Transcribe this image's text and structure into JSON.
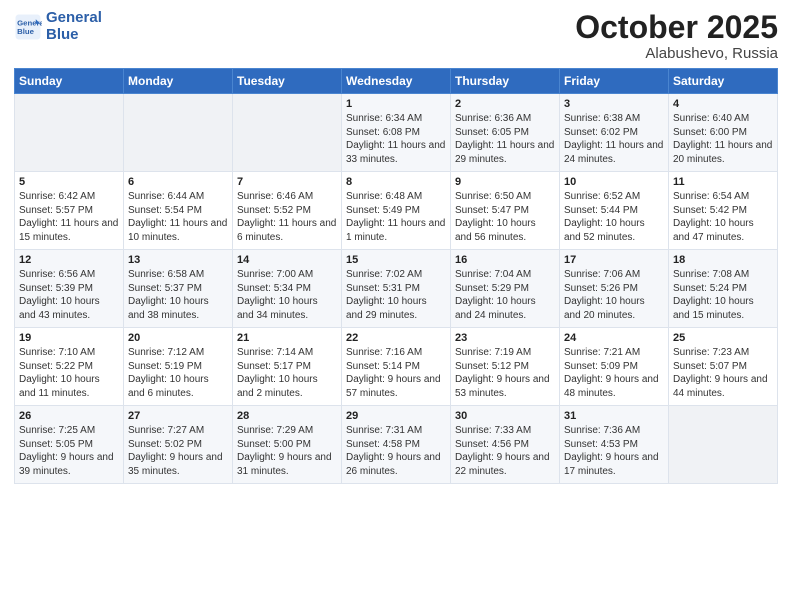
{
  "logo": {
    "line1": "General",
    "line2": "Blue"
  },
  "title": "October 2025",
  "subtitle": "Alabushevo, Russia",
  "headers": [
    "Sunday",
    "Monday",
    "Tuesday",
    "Wednesday",
    "Thursday",
    "Friday",
    "Saturday"
  ],
  "weeks": [
    [
      {
        "day": "",
        "content": ""
      },
      {
        "day": "",
        "content": ""
      },
      {
        "day": "",
        "content": ""
      },
      {
        "day": "1",
        "content": "Sunrise: 6:34 AM\nSunset: 6:08 PM\nDaylight: 11 hours and 33 minutes."
      },
      {
        "day": "2",
        "content": "Sunrise: 6:36 AM\nSunset: 6:05 PM\nDaylight: 11 hours and 29 minutes."
      },
      {
        "day": "3",
        "content": "Sunrise: 6:38 AM\nSunset: 6:02 PM\nDaylight: 11 hours and 24 minutes."
      },
      {
        "day": "4",
        "content": "Sunrise: 6:40 AM\nSunset: 6:00 PM\nDaylight: 11 hours and 20 minutes."
      }
    ],
    [
      {
        "day": "5",
        "content": "Sunrise: 6:42 AM\nSunset: 5:57 PM\nDaylight: 11 hours and 15 minutes."
      },
      {
        "day": "6",
        "content": "Sunrise: 6:44 AM\nSunset: 5:54 PM\nDaylight: 11 hours and 10 minutes."
      },
      {
        "day": "7",
        "content": "Sunrise: 6:46 AM\nSunset: 5:52 PM\nDaylight: 11 hours and 6 minutes."
      },
      {
        "day": "8",
        "content": "Sunrise: 6:48 AM\nSunset: 5:49 PM\nDaylight: 11 hours and 1 minute."
      },
      {
        "day": "9",
        "content": "Sunrise: 6:50 AM\nSunset: 5:47 PM\nDaylight: 10 hours and 56 minutes."
      },
      {
        "day": "10",
        "content": "Sunrise: 6:52 AM\nSunset: 5:44 PM\nDaylight: 10 hours and 52 minutes."
      },
      {
        "day": "11",
        "content": "Sunrise: 6:54 AM\nSunset: 5:42 PM\nDaylight: 10 hours and 47 minutes."
      }
    ],
    [
      {
        "day": "12",
        "content": "Sunrise: 6:56 AM\nSunset: 5:39 PM\nDaylight: 10 hours and 43 minutes."
      },
      {
        "day": "13",
        "content": "Sunrise: 6:58 AM\nSunset: 5:37 PM\nDaylight: 10 hours and 38 minutes."
      },
      {
        "day": "14",
        "content": "Sunrise: 7:00 AM\nSunset: 5:34 PM\nDaylight: 10 hours and 34 minutes."
      },
      {
        "day": "15",
        "content": "Sunrise: 7:02 AM\nSunset: 5:31 PM\nDaylight: 10 hours and 29 minutes."
      },
      {
        "day": "16",
        "content": "Sunrise: 7:04 AM\nSunset: 5:29 PM\nDaylight: 10 hours and 24 minutes."
      },
      {
        "day": "17",
        "content": "Sunrise: 7:06 AM\nSunset: 5:26 PM\nDaylight: 10 hours and 20 minutes."
      },
      {
        "day": "18",
        "content": "Sunrise: 7:08 AM\nSunset: 5:24 PM\nDaylight: 10 hours and 15 minutes."
      }
    ],
    [
      {
        "day": "19",
        "content": "Sunrise: 7:10 AM\nSunset: 5:22 PM\nDaylight: 10 hours and 11 minutes."
      },
      {
        "day": "20",
        "content": "Sunrise: 7:12 AM\nSunset: 5:19 PM\nDaylight: 10 hours and 6 minutes."
      },
      {
        "day": "21",
        "content": "Sunrise: 7:14 AM\nSunset: 5:17 PM\nDaylight: 10 hours and 2 minutes."
      },
      {
        "day": "22",
        "content": "Sunrise: 7:16 AM\nSunset: 5:14 PM\nDaylight: 9 hours and 57 minutes."
      },
      {
        "day": "23",
        "content": "Sunrise: 7:19 AM\nSunset: 5:12 PM\nDaylight: 9 hours and 53 minutes."
      },
      {
        "day": "24",
        "content": "Sunrise: 7:21 AM\nSunset: 5:09 PM\nDaylight: 9 hours and 48 minutes."
      },
      {
        "day": "25",
        "content": "Sunrise: 7:23 AM\nSunset: 5:07 PM\nDaylight: 9 hours and 44 minutes."
      }
    ],
    [
      {
        "day": "26",
        "content": "Sunrise: 7:25 AM\nSunset: 5:05 PM\nDaylight: 9 hours and 39 minutes."
      },
      {
        "day": "27",
        "content": "Sunrise: 7:27 AM\nSunset: 5:02 PM\nDaylight: 9 hours and 35 minutes."
      },
      {
        "day": "28",
        "content": "Sunrise: 7:29 AM\nSunset: 5:00 PM\nDaylight: 9 hours and 31 minutes."
      },
      {
        "day": "29",
        "content": "Sunrise: 7:31 AM\nSunset: 4:58 PM\nDaylight: 9 hours and 26 minutes."
      },
      {
        "day": "30",
        "content": "Sunrise: 7:33 AM\nSunset: 4:56 PM\nDaylight: 9 hours and 22 minutes."
      },
      {
        "day": "31",
        "content": "Sunrise: 7:36 AM\nSunset: 4:53 PM\nDaylight: 9 hours and 17 minutes."
      },
      {
        "day": "",
        "content": ""
      }
    ]
  ]
}
